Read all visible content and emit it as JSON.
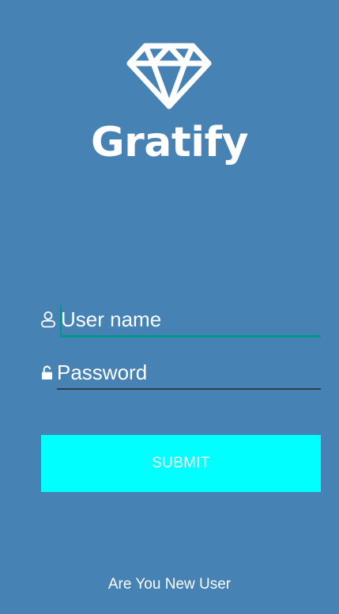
{
  "app": {
    "name": "Gratify",
    "logo_icon": "diamond-icon"
  },
  "login_form": {
    "username": {
      "icon": "user-icon",
      "placeholder": "User name",
      "value": ""
    },
    "password": {
      "icon": "unlock-icon",
      "placeholder": "Password",
      "value": ""
    },
    "submit_label": "SUBMIT",
    "new_user_link": "Are You New User"
  },
  "colors": {
    "background": "#4682b4",
    "submit_button": "#00ffff",
    "active_underline": "#009688",
    "inactive_underline": "#2c3e50",
    "text": "#ffffff"
  }
}
